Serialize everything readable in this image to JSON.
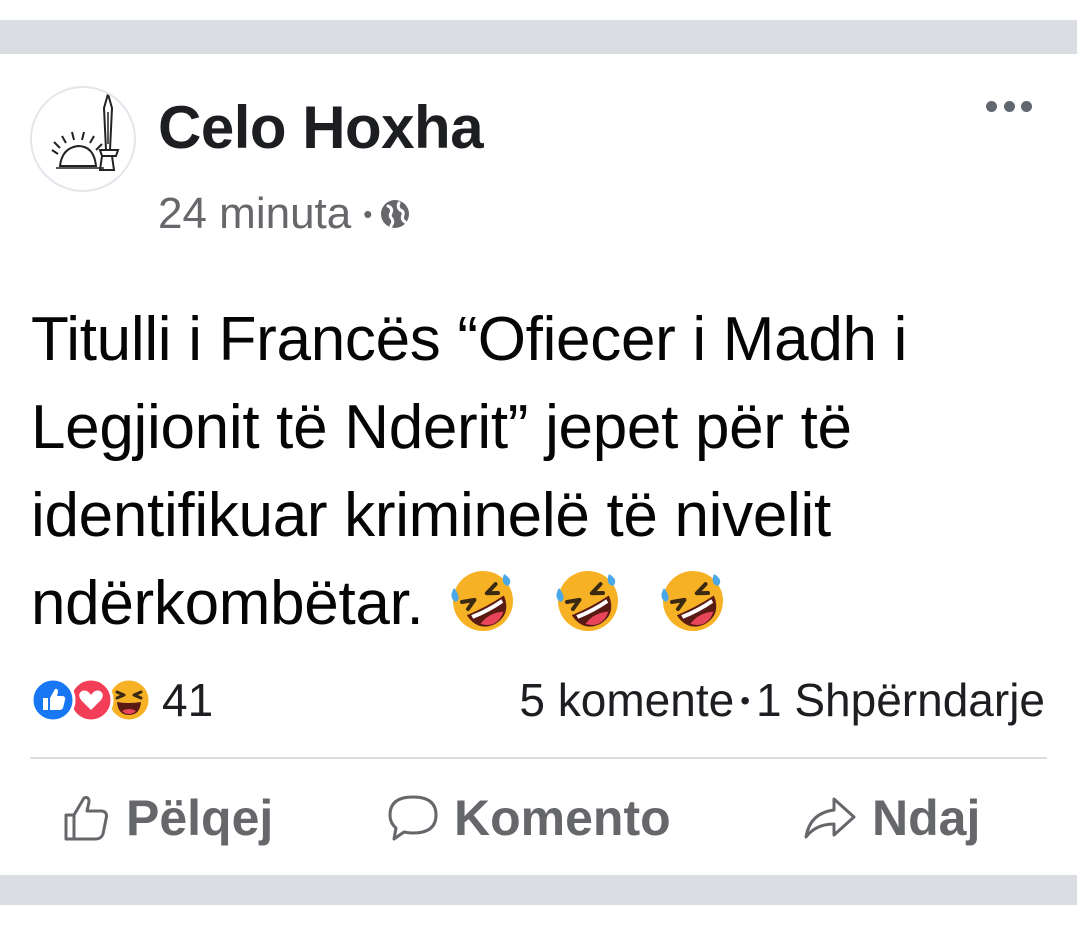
{
  "post": {
    "author": "Celo Hoxha",
    "time": "24 minuta",
    "meta_separator": "•",
    "visibility_icon": "globe-icon",
    "text": "Titulli i Francës “Ofiecer i Madh i Legjionit të Nderit” jepet për të identifikuar kriminelë të nivelit ndërkombëtar.",
    "emojis": [
      "rolling-on-floor-laughing-emoji",
      "rolling-on-floor-laughing-emoji",
      "rolling-on-floor-laughing-emoji"
    ]
  },
  "reactions": {
    "icons": [
      "like-reaction-icon",
      "love-reaction-icon",
      "haha-reaction-icon"
    ],
    "count": "41"
  },
  "stats": {
    "comments": "5 komente",
    "separator": "•",
    "shares": "1 Shpërndarje"
  },
  "actions": {
    "like_label": "Pëlqej",
    "comment_label": "Komento",
    "share_label": "Ndaj"
  },
  "colors": {
    "band": "#dadde1",
    "text_primary": "#050505",
    "text_secondary": "#65676b",
    "like_blue": "#1877f2",
    "love_red": "#f33e58",
    "emoji_yellow": "#f7b125"
  }
}
